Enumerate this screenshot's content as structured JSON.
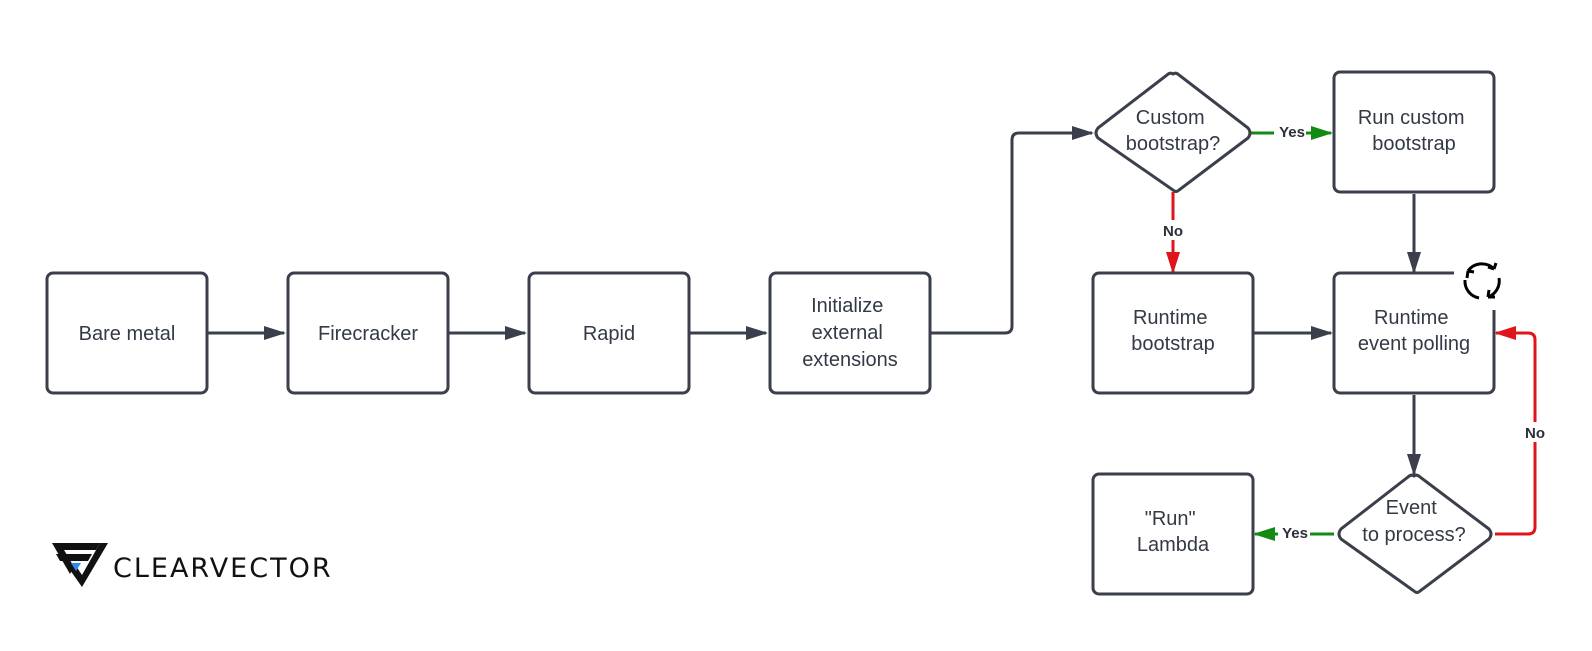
{
  "diagram": {
    "nodes": {
      "bare_metal": {
        "lines": [
          "Bare metal"
        ]
      },
      "firecracker": {
        "lines": [
          "Firecracker"
        ]
      },
      "rapid": {
        "lines": [
          "Rapid"
        ]
      },
      "init_ext": {
        "lines": [
          "Initialize",
          "external",
          "extensions"
        ]
      },
      "custom_bootstrap_q": {
        "lines": [
          "Custom",
          "bootstrap?"
        ]
      },
      "run_custom_bootstrap": {
        "lines": [
          "Run custom",
          "bootstrap"
        ]
      },
      "runtime_bootstrap": {
        "lines": [
          "Runtime",
          "bootstrap"
        ]
      },
      "runtime_event_polling": {
        "lines": [
          "Runtime",
          "event polling"
        ]
      },
      "event_to_process_q": {
        "lines": [
          "Event",
          "to process?"
        ]
      },
      "run_lambda": {
        "lines": [
          "\"Run\"",
          "Lambda"
        ]
      }
    },
    "edge_labels": {
      "custom_yes": "Yes",
      "custom_no": "No",
      "event_yes": "Yes",
      "event_no": "No"
    },
    "colors": {
      "stroke": "#3a3f4b",
      "yes": "#138a13",
      "no": "#e0141b",
      "logo_accent": "#2d8cf0"
    },
    "icons": {
      "loop": "refresh-cycle-icon"
    }
  },
  "logo": {
    "text": "CLEARVECTOR"
  }
}
